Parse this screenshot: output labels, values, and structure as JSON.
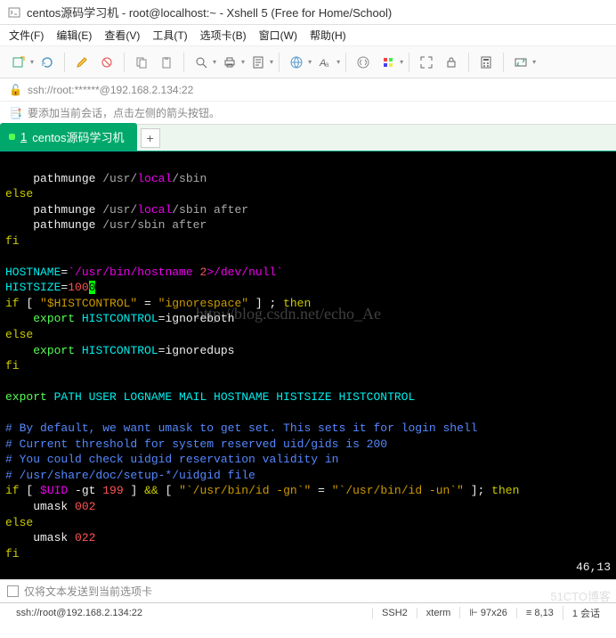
{
  "window": {
    "title": "centos源码学习机 - root@localhost:~ - Xshell 5 (Free for Home/School)"
  },
  "menu": {
    "file": "文件(F)",
    "edit": "编辑(E)",
    "view": "查看(V)",
    "tools": "工具(T)",
    "tabs": "选项卡(B)",
    "window": "窗口(W)",
    "help": "帮助(H)"
  },
  "address": {
    "text": "ssh://root:******@192.168.2.134:22"
  },
  "hint": {
    "text": "要添加当前会话，点击左侧的箭头按钮。"
  },
  "tab": {
    "num": "1",
    "label": "centos源码学习机",
    "add": "+"
  },
  "term": {
    "l1a": "    pathmunge ",
    "l1b": "/usr/",
    "l1c": "local",
    "l1d": "/sbin",
    "l2": "else",
    "l3a": "    pathmunge ",
    "l3b": "/usr/",
    "l3c": "local",
    "l3d": "/sbin after",
    "l4a": "    pathmunge ",
    "l4b": "/usr/sbin after",
    "l5": "fi",
    "l7a": "HOSTNAME",
    "l7b": "=",
    "l7c": "`/usr/bin/hostname ",
    "l7d": "2",
    "l7e": ">/dev/null`",
    "l8a": "HISTSIZE",
    "l8b": "=",
    "l8c": "100",
    "l8d": "0",
    "l9a": "if",
    "l9b": " [ ",
    "l9c": "\"$HISTCONTROL\"",
    "l9d": " = ",
    "l9e": "\"ignorespace\"",
    "l9f": " ] ; ",
    "l9g": "then",
    "l10a": "    ",
    "l10b": "export",
    "l10c": " ",
    "l10d": "HISTCONTROL",
    "l10e": "=ignoreboth",
    "l11": "else",
    "l12a": "    ",
    "l12b": "export",
    "l12c": " ",
    "l12d": "HISTCONTROL",
    "l12e": "=ignoredups",
    "l13": "fi",
    "l15a": "export",
    "l15b": " PATH USER LOGNAME MAIL HOSTNAME HISTSIZE HISTCONTROL",
    "l17": "# By default, we want umask to get set. This sets it for login shell",
    "l18": "# Current threshold for system reserved uid/gids is 200",
    "l19": "# You could check uidgid reservation validity in",
    "l20": "# /usr/share/doc/setup-*/uidgid file",
    "l21a": "if",
    "l21b": " [ ",
    "l21c": "$UID",
    "l21d": " -gt ",
    "l21e": "199",
    "l21f": " ] ",
    "l21g": "&&",
    "l21h": " [ ",
    "l21i": "\"`/usr/bin/id -gn`\"",
    "l21j": " = ",
    "l21k": "\"`/usr/bin/id -un`\"",
    "l21l": " ]; ",
    "l21m": "then",
    "l22a": "    umask ",
    "l22b": "002",
    "l23": "else",
    "l24a": "    umask ",
    "l24b": "022",
    "l25": "fi",
    "pos": "46,13"
  },
  "watermark": {
    "url": "http://blog.csdn.net/echo_Ae",
    "corner": "51CTO博客"
  },
  "sendbar": {
    "text": "仅将文本发送到当前选项卡"
  },
  "status": {
    "conn": "ssh://root@192.168.2.134:22",
    "proto": "SSH2",
    "term": "xterm",
    "size": "97x26",
    "cursor": "8,13",
    "sess": "1 会话"
  }
}
